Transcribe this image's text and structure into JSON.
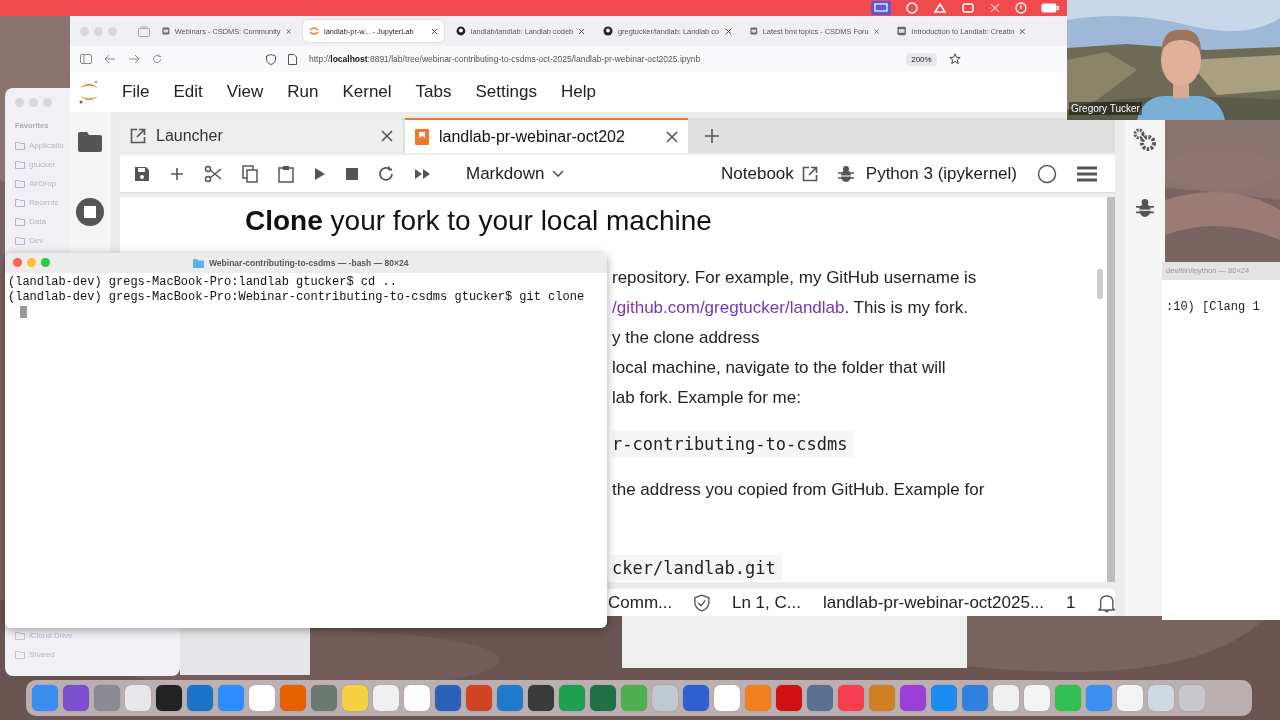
{
  "browser": {
    "tabs": [
      {
        "title": "Webinars - CSDMS: Community",
        "selected": false,
        "kind": "doc"
      },
      {
        "title": "landlab-pr-w... - JupyterLab",
        "selected": true,
        "kind": "jupyter"
      },
      {
        "title": "landlab/landlab: Landlab codeb",
        "selected": false,
        "kind": "github"
      },
      {
        "title": "gregtucker/landlab: Landlab co",
        "selected": false,
        "kind": "github"
      },
      {
        "title": "Latest bmi topics - CSDMS Foru",
        "selected": false,
        "kind": "doc"
      },
      {
        "title": "Introduction to Landlab: Creatin",
        "selected": false,
        "kind": "doc"
      }
    ],
    "url": "http://**localhost**:8891/lab/tree/webinar-contributing-to-csdms-oct-2025/landlab-pr-webinar-oct2025.ipynb",
    "zoom": "200%"
  },
  "jupyter": {
    "menu": [
      "File",
      "Edit",
      "View",
      "Run",
      "Kernel",
      "Tabs",
      "Settings",
      "Help"
    ],
    "tabs": [
      {
        "label": "Launcher",
        "selected": false,
        "kind": "launcher"
      },
      {
        "label": "landlab-pr-webinar-oct202",
        "selected": true,
        "kind": "notebook"
      }
    ],
    "cell_type": "Markdown",
    "notebook_label": "Notebook",
    "kernel": "Python 3 (ipykernel)",
    "heading": "**Clone** your fork to your local machine",
    "lines": [
      {
        "kind": "text",
        "text": "repository. For example, my GitHub username is"
      },
      {
        "kind": "link",
        "link": "/github.com/gregtucker/landlab",
        "text": ". This is my fork."
      },
      {
        "kind": "text",
        "text": "y the clone address"
      },
      {
        "kind": "text",
        "text": "local machine, navigate to the folder that will"
      },
      {
        "kind": "text",
        "text": "lab fork. Example for me:"
      },
      {
        "kind": "code",
        "text": "r-contributing-to-csdms"
      },
      {
        "kind": "text",
        "text": "the address you copied from GitHub. Example for"
      },
      {
        "kind": "code",
        "text": "cker/landlab.git"
      }
    ],
    "status": {
      "mode": "Comm...",
      "position": "Ln 1, C...",
      "file": "landlab-pr-webinar-oct2025...",
      "notifications": "1"
    }
  },
  "finder": {
    "section": "Favorites",
    "items": [
      "Applicatio",
      "gtucker",
      "AirDrop",
      "Recents",
      "Data",
      "Dev"
    ],
    "bottom_items": [
      "iCloud Drive",
      "Shared"
    ]
  },
  "terminal": {
    "title": "Webinar-contributing-to-csdms — -bash — 80×24",
    "lines": [
      "(landlab-dev) gregs-MacBook-Pro:landlab gtucker$ cd ..",
      "(landlab-dev) gregs-MacBook-Pro:Webinar-contributing-to-csdms gtucker$ git clone"
    ]
  },
  "terminal2": {
    "title": "dev/bin/ipython — 80×24",
    "lines": [
      ":10) [Clang 1"
    ]
  },
  "video": {
    "name": "Gregory Tucker"
  }
}
